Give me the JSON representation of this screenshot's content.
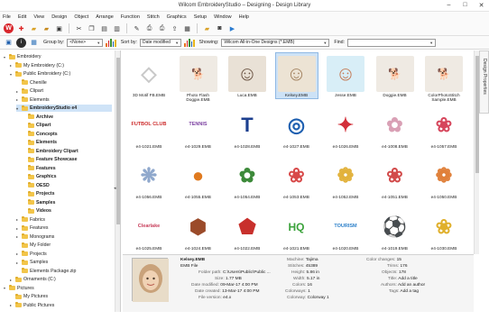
{
  "window": {
    "title": "Wilcom EmbroideryStudio – Designing - Design Library",
    "controls": [
      "–",
      "□",
      "✕"
    ]
  },
  "menu": [
    "File",
    "Edit",
    "View",
    "Design",
    "Object",
    "Arrange",
    "Function",
    "Stitch",
    "Graphics",
    "Setup",
    "Window",
    "Help"
  ],
  "toolbar2": {
    "group_label": "Group by:",
    "group_value": "<None>",
    "sort_label": "Sort by:",
    "sort_value": "Date modified",
    "showing_label": "Showing:",
    "showing_value": "Wilcom All-in-One Designs (*.EMB)",
    "find_label": "Find:",
    "find_value": ""
  },
  "tree": [
    {
      "label": "Embroidery",
      "indent": 0,
      "exp": "▾"
    },
    {
      "label": "My Embroidery (C:)",
      "indent": 1,
      "exp": "▸"
    },
    {
      "label": "Public Embroidery (C:)",
      "indent": 1,
      "exp": "▾"
    },
    {
      "label": "Chenille",
      "indent": 2,
      "exp": ""
    },
    {
      "label": "Clipart",
      "indent": 2,
      "exp": "▸"
    },
    {
      "label": "Elements",
      "indent": 2,
      "exp": "▸"
    },
    {
      "label": "EmbroideryStudio e4",
      "indent": 2,
      "exp": "▾",
      "bold": true,
      "selected": true
    },
    {
      "label": "Archive",
      "indent": 3,
      "exp": "",
      "bold": true
    },
    {
      "label": "Clipart",
      "indent": 3,
      "exp": "",
      "bold": true
    },
    {
      "label": "Concepts",
      "indent": 3,
      "exp": "",
      "bold": true
    },
    {
      "label": "Elements",
      "indent": 3,
      "exp": "",
      "bold": true
    },
    {
      "label": "Embroidery Clipart",
      "indent": 3,
      "exp": "",
      "bold": true
    },
    {
      "label": "Feature Showcase",
      "indent": 3,
      "exp": "",
      "bold": true
    },
    {
      "label": "Features",
      "indent": 3,
      "exp": "",
      "bold": true
    },
    {
      "label": "Graphics",
      "indent": 3,
      "exp": "",
      "bold": true
    },
    {
      "label": "OESD",
      "indent": 3,
      "exp": "",
      "bold": true
    },
    {
      "label": "Projects",
      "indent": 3,
      "exp": "",
      "bold": true
    },
    {
      "label": "Samples",
      "indent": 3,
      "exp": "",
      "bold": true
    },
    {
      "label": "Videos",
      "indent": 3,
      "exp": "",
      "bold": true
    },
    {
      "label": "Fabrics",
      "indent": 2,
      "exp": "▸"
    },
    {
      "label": "Features",
      "indent": 2,
      "exp": "▸"
    },
    {
      "label": "Monograms",
      "indent": 2,
      "exp": "▸"
    },
    {
      "label": "My Folder",
      "indent": 2,
      "exp": ""
    },
    {
      "label": "Projects",
      "indent": 2,
      "exp": "▸"
    },
    {
      "label": "Samples",
      "indent": 2,
      "exp": "▸"
    },
    {
      "label": "Elements Package.zip",
      "indent": 2,
      "exp": ""
    },
    {
      "label": "Ornaments (C:)",
      "indent": 1,
      "exp": "▸"
    },
    {
      "label": "Pictures",
      "indent": 0,
      "exp": "▾"
    },
    {
      "label": "My Pictures",
      "indent": 1,
      "exp": ""
    },
    {
      "label": "Public Pictures",
      "indent": 1,
      "exp": "▸"
    }
  ],
  "designs": [
    {
      "caption": "3D Motif FB.EMB",
      "icon": "3d-motif-icon",
      "bg": "#ffffff",
      "fg": "#c9c9c9",
      "glyph": "◇"
    },
    {
      "caption": "Photo Flash Doggie.EMB",
      "icon": "dog-photo-icon",
      "bg": "#efeae3",
      "fg": "#8c7a66",
      "glyph": "🐕"
    },
    {
      "caption": "Luca.EMB",
      "icon": "portrait-icon",
      "bg": "#e9e1d6",
      "fg": "#6b5443",
      "glyph": "☺"
    },
    {
      "caption": "Kelsey.EMB",
      "icon": "portrait-icon",
      "bg": "#ece3d4",
      "fg": "#a48462",
      "glyph": "☺",
      "selected": true
    },
    {
      "caption": "Jesse.EMB",
      "icon": "child-portrait-icon",
      "bg": "#d8eef7",
      "fg": "#c47a55",
      "glyph": "☺"
    },
    {
      "caption": "Doggie.EMB",
      "icon": "dog-icon",
      "bg": "#efeae3",
      "fg": "#8a5a3e",
      "glyph": "🐕"
    },
    {
      "caption": "ColorPhotoStitch Sample.EMB",
      "icon": "dog-icon",
      "bg": "#efeae3",
      "fg": "#9a6e4c",
      "glyph": "🐕"
    },
    {
      "caption": "e4-1021.EMB",
      "icon": "futbol-club-icon",
      "bg": "#ffffff",
      "fg": "#cc2a2a",
      "glyph": "FUTBOL CLUB"
    },
    {
      "caption": "e4-1029.EMB",
      "icon": "tennis-icon",
      "bg": "#ffffff",
      "fg": "#7b3fa0",
      "glyph": "TENNIS"
    },
    {
      "caption": "e4-1028.EMB",
      "icon": "letter-icon",
      "bg": "#ffffff",
      "fg": "#1c3f8f",
      "glyph": "T"
    },
    {
      "caption": "e4-1027.EMB",
      "icon": "badge-icon",
      "bg": "#ffffff",
      "fg": "#1d5fb0",
      "glyph": "◎"
    },
    {
      "caption": "e4-1026.EMB",
      "icon": "fish-icon",
      "bg": "#ffffff",
      "fg": "#d2303a",
      "glyph": "✦"
    },
    {
      "caption": "e4-1008.EMB",
      "icon": "rose-icon",
      "bg": "#ffffff",
      "fg": "#d9a0b5",
      "glyph": "✿"
    },
    {
      "caption": "e4-1057.EMB",
      "icon": "flower-icon",
      "bg": "#ffffff",
      "fg": "#d6465c",
      "glyph": "❀"
    },
    {
      "caption": "e4-1056.EMB",
      "icon": "lace-icon",
      "bg": "#ffffff",
      "fg": "#8fa8cc",
      "glyph": "❋"
    },
    {
      "caption": "e4-1055.EMB",
      "icon": "pumpkin-icon",
      "bg": "#ffffff",
      "fg": "#e07a1f",
      "glyph": "●"
    },
    {
      "caption": "e4-1054.EMB",
      "icon": "owl-icon",
      "bg": "#ffffff",
      "fg": "#3d8a3a",
      "glyph": "✿"
    },
    {
      "caption": "e4-1053.EMB",
      "icon": "flowers-icon",
      "bg": "#ffffff",
      "fg": "#d84a4a",
      "glyph": "❀"
    },
    {
      "caption": "e4-1052.EMB",
      "icon": "flowers-icon",
      "bg": "#ffffff",
      "fg": "#e2b23c",
      "glyph": "❁"
    },
    {
      "caption": "e4-1051.EMB",
      "icon": "flowers-icon",
      "bg": "#ffffff",
      "fg": "#d24b4b",
      "glyph": "❀"
    },
    {
      "caption": "e4-1050.EMB",
      "icon": "butterfly-icon",
      "bg": "#ffffff",
      "fg": "#e0803a",
      "glyph": "❁"
    },
    {
      "caption": "e4-1025.EMB",
      "icon": "clearlake-icon",
      "bg": "#ffffff",
      "fg": "#c83d5a",
      "glyph": "Clearlake"
    },
    {
      "caption": "e4-1024.EMB",
      "icon": "winged-badge-icon",
      "bg": "#ffffff",
      "fg": "#9b4b2a",
      "glyph": "⬢"
    },
    {
      "caption": "e4-1022.EMB",
      "icon": "crest-icon",
      "bg": "#ffffff",
      "fg": "#c8302c",
      "glyph": "⬟"
    },
    {
      "caption": "e4-1021.EMB",
      "icon": "hq-letters-icon",
      "bg": "#ffffff",
      "fg": "#3aa23a",
      "glyph": "HQ"
    },
    {
      "caption": "e4-1020.EMB",
      "icon": "tourism-icon",
      "bg": "#ffffff",
      "fg": "#2a7fc9",
      "glyph": "TOURISM"
    },
    {
      "caption": "e4-1019.EMB",
      "icon": "soccer-club-icon",
      "bg": "#ffffff",
      "fg": "#c22a2a",
      "glyph": "⚽"
    },
    {
      "caption": "e4-1030.EMB",
      "icon": "flowers-icon",
      "bg": "#ffffff",
      "fg": "#e0b02c",
      "glyph": "❀"
    }
  ],
  "info": {
    "name": "Kelsey.EMB",
    "filetype": "EMB File",
    "folder_path_label": "Folder path:",
    "folder_path": "C:\\Users\\Public\\Public ...",
    "size_label": "Size:",
    "size": "1.77 MB",
    "date_modified_label": "Date modified:",
    "date_modified": "09-Mar-17 4:00 PM",
    "date_created_label": "Date created:",
    "date_created": "13-Mar-17 4:00 PM",
    "file_version_label": "File version:",
    "file_version": "e4.x",
    "machine_label": "Machine:",
    "machine": "Tajima",
    "stitches_label": "Stitches:",
    "stitches": "45389",
    "height_label": "Height:",
    "height": "5.86 in",
    "width_label": "Width:",
    "width": "5.17 in",
    "colors_label": "Colors:",
    "colors": "16",
    "colorways_label": "Colorways:",
    "colorways": "1",
    "colorway_label": "Colorway:",
    "colorway": "Colorway 1",
    "color_changes_label": "Color changes:",
    "color_changes": "15",
    "trims_label": "Trims:",
    "trims": "176",
    "objects_label": "Objects:",
    "objects": "178",
    "title_label": "Title:",
    "title": "Add a title",
    "authors_label": "Authors:",
    "authors": "Add an author",
    "tags_label": "Tags:",
    "tags": "Add a tag"
  },
  "side_tab": "Design Properties"
}
